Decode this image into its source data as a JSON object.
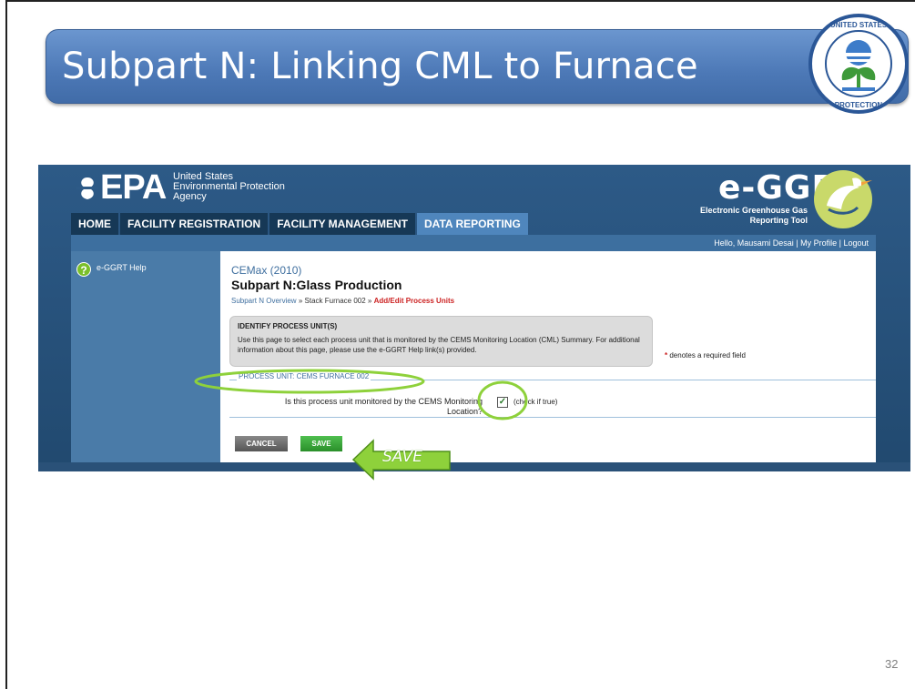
{
  "slide": {
    "title": "Subpart N: Linking CML to Furnace",
    "page_number": "32",
    "annotation_save": "SAVE"
  },
  "header": {
    "agency_lines": [
      "United States",
      "Environmental Protection",
      "Agency"
    ],
    "epa_wordmark": "EPA",
    "app_title": "e-GGRT",
    "app_subtitle_lines": [
      "Electronic Greenhouse Gas",
      "Reporting Tool"
    ]
  },
  "tabs": [
    {
      "label": "HOME",
      "active": false
    },
    {
      "label": "FACILITY REGISTRATION",
      "active": false
    },
    {
      "label": "FACILITY MANAGEMENT",
      "active": false
    },
    {
      "label": "DATA REPORTING",
      "active": true
    }
  ],
  "userbar": {
    "greeting": "Hello, Mausami Desai",
    "my_profile": "My Profile",
    "logout": "Logout"
  },
  "sidebar": {
    "help_label": "e-GGRT Help"
  },
  "content": {
    "facility": "CEMax (2010)",
    "subpart": "Subpart N:Glass Production",
    "breadcrumb": {
      "overview": "Subpart N Overview",
      "sep": "»",
      "furnace": "Stack Furnace 002",
      "current": "Add/Edit Process Units"
    },
    "identify_title": "IDENTIFY PROCESS UNIT(S)",
    "identify_text": "Use this page to select each process unit that is monitored by the CEMS Monitoring Location (CML) Summary. For additional information about this page, please use the e-GGRT Help link(s) provided.",
    "required_note": "denotes a required field",
    "process_unit_label": "PROCESS UNIT: CEMS FURNACE 002",
    "question": "Is this process unit monitored by the CEMS Monitoring Location?",
    "checkbox_checked": true,
    "checkbox_hint": "(check if true)",
    "cancel_label": "CANCEL",
    "save_label": "SAVE"
  },
  "colors": {
    "title_bar": "#4c78b6",
    "screenshot_bg": "#2d5a87",
    "annotation_green": "#8ed13b",
    "active_tab": "#4f86bd"
  }
}
